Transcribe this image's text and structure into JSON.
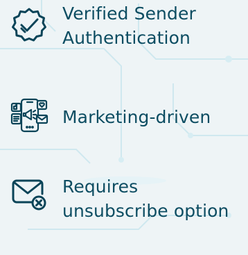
{
  "features": [
    {
      "icon": "verified-badge-icon",
      "label": "Verified Sender Authentication"
    },
    {
      "icon": "mobile-marketing-icon",
      "label": "Marketing-driven"
    },
    {
      "icon": "mail-unsubscribe-icon",
      "label": "Requires unsubscribe option"
    }
  ],
  "colors": {
    "text": "#0d4d62",
    "icon_stroke": "#0a4458",
    "background": "#eef4f6",
    "circuit_lines": "#c9e6ee"
  }
}
